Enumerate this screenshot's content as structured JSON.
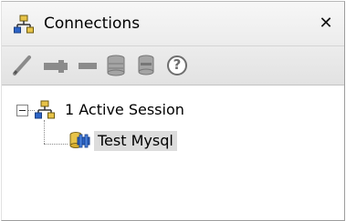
{
  "panel": {
    "title": "Connections",
    "title_icon": "network-tree-icon",
    "close_glyph": "✕"
  },
  "toolbar": {
    "buttons": [
      {
        "icon": "pencil-edit-icon"
      },
      {
        "icon": "disconnect-plug-icon"
      },
      {
        "icon": "minus-remove-icon"
      },
      {
        "icon": "database-icon"
      },
      {
        "icon": "database-stack-icon"
      },
      {
        "icon": "help-icon",
        "glyph": "?"
      }
    ]
  },
  "tree": {
    "root": {
      "label": "1 Active Session",
      "expanded": true,
      "children": [
        {
          "label": "Test Mysql",
          "selected": true
        }
      ]
    }
  },
  "colors": {
    "selection": "#dcdcdc",
    "network_icon_yellow": "#e7c348",
    "network_icon_blue": "#2c64c7",
    "toolbar_icon_gray": "#8b8b8b"
  }
}
